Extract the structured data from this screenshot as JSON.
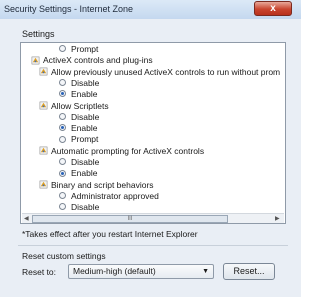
{
  "window": {
    "title": "Security Settings - Internet Zone",
    "close_glyph": "x"
  },
  "settings_group": {
    "label": "Settings"
  },
  "tree": {
    "items": [
      {
        "kind": "radio",
        "indent": 2,
        "label": "Prompt",
        "checked": false
      },
      {
        "kind": "category",
        "indent": 0,
        "label": "ActiveX controls and plug-ins",
        "icon": "security-settings-icon"
      },
      {
        "kind": "category",
        "indent": 1,
        "label": "Allow previously unused ActiveX controls to run without prom",
        "icon": "security-settings-icon"
      },
      {
        "kind": "radio",
        "indent": 2,
        "label": "Disable",
        "checked": false
      },
      {
        "kind": "radio",
        "indent": 2,
        "label": "Enable",
        "checked": true
      },
      {
        "kind": "category",
        "indent": 1,
        "label": "Allow Scriptlets",
        "icon": "security-settings-icon"
      },
      {
        "kind": "radio",
        "indent": 2,
        "label": "Disable",
        "checked": false
      },
      {
        "kind": "radio",
        "indent": 2,
        "label": "Enable",
        "checked": true
      },
      {
        "kind": "radio",
        "indent": 2,
        "label": "Prompt",
        "checked": false
      },
      {
        "kind": "category",
        "indent": 1,
        "label": "Automatic prompting for ActiveX controls",
        "icon": "security-settings-icon"
      },
      {
        "kind": "radio",
        "indent": 2,
        "label": "Disable",
        "checked": false
      },
      {
        "kind": "radio",
        "indent": 2,
        "label": "Enable",
        "checked": true
      },
      {
        "kind": "category",
        "indent": 1,
        "label": "Binary and script behaviors",
        "icon": "security-settings-icon"
      },
      {
        "kind": "radio",
        "indent": 2,
        "label": "Administrator approved",
        "checked": false
      },
      {
        "kind": "radio",
        "indent": 2,
        "label": "Disable",
        "checked": false
      },
      {
        "kind": "radio",
        "indent": 2,
        "label": "Enable",
        "checked": true
      }
    ],
    "hscroll_thumb_glyph": "III"
  },
  "note": "*Takes effect after you restart Internet Explorer",
  "reset": {
    "section_label": "Reset custom settings",
    "reset_to_label": "Reset to:",
    "selected_level": "Medium-high (default)",
    "button_label": "Reset..."
  },
  "colors": {
    "titlebar": "#c4d8ef",
    "close_button": "#c9452f",
    "radio_selected": "#2a63b8"
  }
}
